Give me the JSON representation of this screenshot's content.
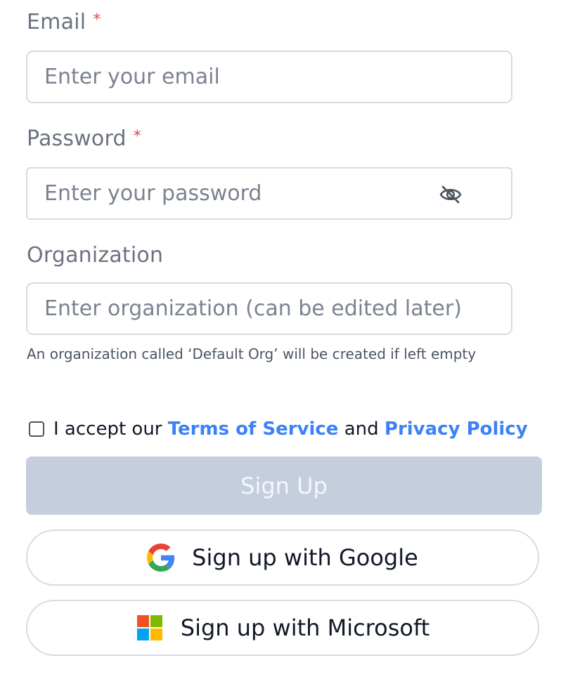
{
  "email": {
    "label": "Email",
    "required_mark": "*",
    "placeholder": "Enter your email"
  },
  "password": {
    "label": "Password",
    "required_mark": "*",
    "placeholder": "Enter your password"
  },
  "organization": {
    "label": "Organization",
    "placeholder": "Enter organization (can be edited later)",
    "hint": "An organization called ‘Default Org’ will be created if left empty"
  },
  "terms": {
    "prefix": "I accept our",
    "terms_link": "Terms of Service",
    "conjunction": "and",
    "privacy_link": "Privacy Policy"
  },
  "buttons": {
    "signup": "Sign Up",
    "google": "Sign up with Google",
    "microsoft": "Sign up with Microsoft"
  },
  "colors": {
    "required": "#e5484d",
    "link": "#3b82f6",
    "signup_disabled_bg": "#c5cedd"
  },
  "icons": {
    "password_toggle": "eye-off-icon",
    "google": "google-logo-icon",
    "microsoft": "microsoft-logo-icon"
  }
}
